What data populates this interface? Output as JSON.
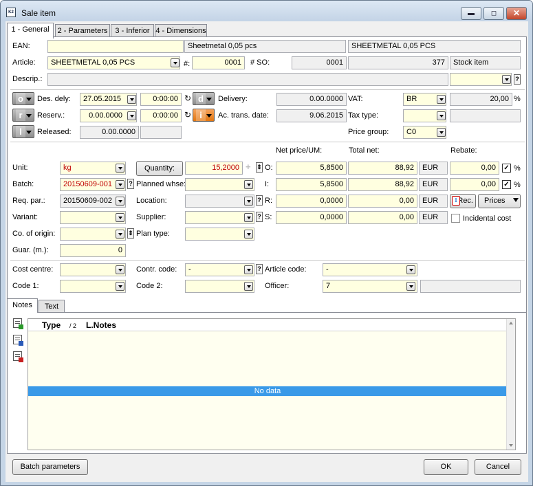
{
  "window": {
    "title": "Sale item",
    "app_icon": "K2"
  },
  "tabs": [
    "1 - General",
    "2 - Parameters",
    "3 - Inferior",
    "4 - Dimensions"
  ],
  "general": {
    "ean": {
      "label": "EAN:",
      "value": "",
      "name_short": "Sheetmetal 0,05 pcs",
      "name_full": "SHEETMETAL 0,05 PCS"
    },
    "article": {
      "label": "Article:",
      "value": "SHEETMETAL 0,05 PCS",
      "hash_label": "#:",
      "hash_value": "0001",
      "so_label": "# SO:",
      "so_value": "0001",
      "so_num": "377",
      "stock_type": "Stock item"
    },
    "descrip": {
      "label": "Descrip.:",
      "value": "",
      "extra": ""
    }
  },
  "dates": {
    "des_dely": {
      "state_letter": "o",
      "label": "Des. dely:",
      "date": "27.05.2015",
      "time": "0:00:00"
    },
    "reserv": {
      "state_letter": "r",
      "label": "Reserv.:",
      "date": "0.00.0000",
      "time": "0:00:00"
    },
    "released": {
      "state_letter": "l",
      "label": "Released:",
      "date": "0.00.0000",
      "time": ""
    },
    "delivery": {
      "state_letter": "d",
      "label": "Delivery:",
      "value": "0.00.0000"
    },
    "ac_trans": {
      "state_letter": "i",
      "label": "Ac. trans. date:",
      "value": "9.06.2015"
    },
    "vat": {
      "label": "VAT:",
      "code": "BR",
      "rate": "20,00",
      "unit": "%"
    },
    "tax_type": {
      "label": "Tax type:",
      "value": "",
      "extra": ""
    },
    "price_group": {
      "label": "Price group:",
      "value": "C0"
    }
  },
  "qty": {
    "unit": {
      "label": "Unit:",
      "value": "kg"
    },
    "quantity_button": "Quantity:",
    "quantity": "15,2000",
    "batch": {
      "label": "Batch:",
      "value": "20150609-001"
    },
    "planned_whse": {
      "label": "Planned whse:",
      "value": ""
    },
    "req_par": {
      "label": "Req. par.:",
      "value": "20150609-002"
    },
    "location": {
      "label": "Location:",
      "value": ""
    },
    "variant": {
      "label": "Variant:",
      "value": ""
    },
    "supplier": {
      "label": "Supplier:",
      "value": ""
    },
    "co_origin": {
      "label": "Co. of origin:",
      "value": ""
    },
    "plan_type": {
      "label": "Plan type:",
      "value": ""
    },
    "guar": {
      "label": "Guar. (m.):",
      "value": "0"
    },
    "col_net_price": "Net price/UM:",
    "col_total_net": "Total net:",
    "col_rebate": "Rebate:",
    "rows": [
      {
        "label": "O:",
        "net": "5,8500",
        "total": "88,92",
        "cur": "EUR",
        "rebate": "0,00",
        "pct": "%",
        "checked": true
      },
      {
        "label": "I:",
        "net": "5,8500",
        "total": "88,92",
        "cur": "EUR",
        "rebate": "0,00",
        "pct": "%",
        "checked": true
      },
      {
        "label": "R:",
        "net": "0,0000",
        "total": "0,00",
        "cur": "EUR"
      },
      {
        "label": "S:",
        "net": "0,0000",
        "total": "0,00",
        "cur": "EUR"
      }
    ],
    "rec_button": "Rec.",
    "prices_button": "Prices",
    "incidental_cost": "Incidental cost"
  },
  "codes": {
    "cost_centre": {
      "label": "Cost centre:",
      "value": ""
    },
    "contr_code": {
      "label": "Contr. code:",
      "value": "-"
    },
    "article_code": {
      "label": "Article code:",
      "value": "-"
    },
    "code1": {
      "label": "Code 1:",
      "value": ""
    },
    "code2": {
      "label": "Code 2:",
      "value": ""
    },
    "officer": {
      "label": "Officer:",
      "value": "7",
      "extra": ""
    }
  },
  "notes": {
    "tabs": [
      "Notes",
      "Text"
    ],
    "columns": {
      "type": "Type",
      "sort": "/ 2",
      "notes": "L.Notes"
    },
    "empty": "No data"
  },
  "footer": {
    "batch_params": "Batch parameters",
    "ok": "OK",
    "cancel": "Cancel"
  }
}
